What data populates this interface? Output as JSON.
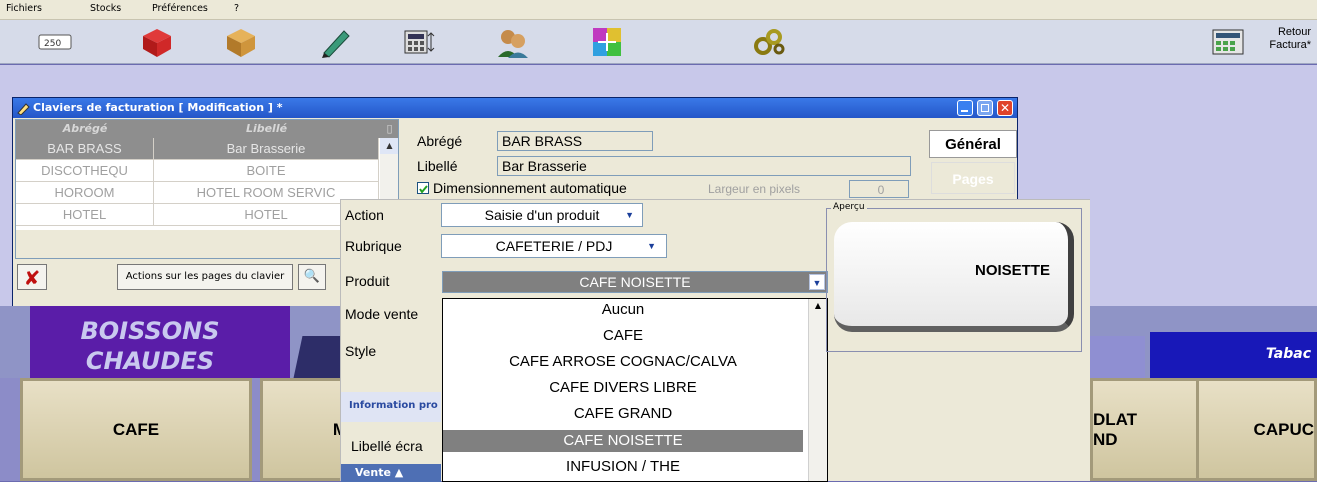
{
  "menubar": {
    "items": [
      "Fichiers",
      "Stocks",
      "Préférences",
      "?"
    ]
  },
  "toolbar": {
    "buttons": [
      "ticket-250-icon",
      "box-red-icon",
      "box-brown-icon",
      "pen-icon",
      "calculator-icon",
      "users-icon",
      "grid-icon",
      "gears-icon"
    ],
    "retour_line1": "Retour",
    "retour_line2": "Factura*"
  },
  "dialog": {
    "title": "Claviers de facturation  [ Modification ] *",
    "list": {
      "headers": [
        "Abrégé",
        "Libellé"
      ],
      "rows": [
        {
          "abrege": "BAR BRASS",
          "libelle": "Bar Brasserie"
        },
        {
          "abrege": "DISCOTHEQU",
          "libelle": "BOITE"
        },
        {
          "abrege": "HOROOM",
          "libelle": "HOTEL ROOM SERVIC"
        },
        {
          "abrege": "HOTEL",
          "libelle": "HOTEL"
        }
      ]
    },
    "actions_button": "Actions sur les pages du clavier",
    "abrege_label": "Abrégé",
    "abrege_value": "BAR BRASS",
    "libelle_label": "Libellé",
    "libelle_value": "Bar Brasserie",
    "dimension_label": "Dimensionnement automatique",
    "largeur_label": "Largeur en pixels",
    "largeur_value": "0",
    "tab_general": "Général",
    "tab_pages": "Pages"
  },
  "keyboard": {
    "tab_boissons_1": "BOISSONS",
    "tab_boissons_2": "CHAUDES",
    "tab_tabac": "Tabac",
    "keys": [
      "CAFE",
      "M",
      "DLAT",
      "ND",
      "CAPUC"
    ]
  },
  "popup": {
    "action_label": "Action",
    "action_value": "Saisie d'un produit",
    "rubrique_label": "Rubrique",
    "rubrique_value": "CAFETERIE / PDJ",
    "produit_label": "Produit",
    "produit_value": "CAFE NOISETTE",
    "mode_vente_label": "Mode vente",
    "style_label": "Style",
    "info_label": "Information pro",
    "libelle_ecran_label": "Libellé écra",
    "vente_label": "Vente",
    "dropdown_items": [
      "Aucun",
      "CAFE",
      "CAFE ARROSE COGNAC/CALVA",
      "CAFE DIVERS LIBRE",
      "CAFE GRAND",
      "CAFE NOISETTE",
      "INFUSION / THE"
    ],
    "dropdown_selected": "CAFE NOISETTE",
    "apercu_label": "Aperçu",
    "apercu_text": "NOISETTE"
  }
}
